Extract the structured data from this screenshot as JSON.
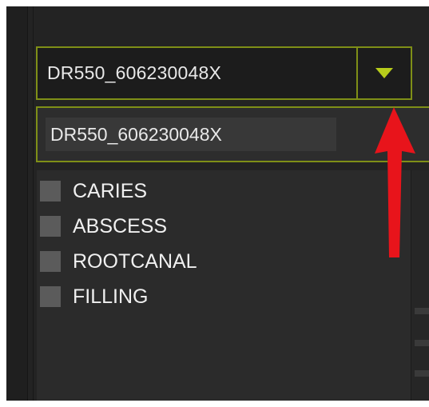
{
  "device_select": {
    "value": "DR550_606230048X",
    "options": [
      "DR550_606230048X"
    ]
  },
  "legend": {
    "items": [
      {
        "label": "CARIES"
      },
      {
        "label": "ABSCESS"
      },
      {
        "label": "ROOTCANAL"
      },
      {
        "label": "FILLING"
      }
    ]
  },
  "icons": {
    "dropdown_arrow": "triangle-down-icon",
    "annotation": "red-arrow-icon"
  },
  "colors": {
    "accent": "#7f8f17",
    "arrow_fill": "#b7cc1b",
    "annotation_arrow": "#e8141b",
    "background": "#232323",
    "text": "#e8e8e8"
  }
}
